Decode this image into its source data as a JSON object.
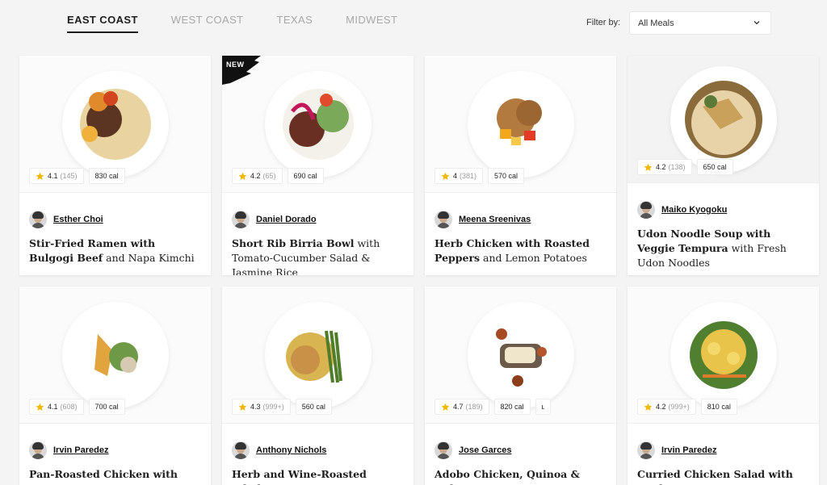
{
  "tabs": [
    {
      "label": "EAST COAST",
      "active": true
    },
    {
      "label": "WEST COAST",
      "active": false
    },
    {
      "label": "TEXAS",
      "active": false
    },
    {
      "label": "MIDWEST",
      "active": false
    }
  ],
  "filter": {
    "label": "Filter by:",
    "selected": "All Meals"
  },
  "colors": {
    "star": "#f5b800",
    "text": "#1e1e1e",
    "muted": "#a8a8a8",
    "badge": "#111111"
  },
  "cards": [
    {
      "rating": "4.1",
      "count": "(145)",
      "cal": "830 cal",
      "chef": "Esther Choi",
      "title_bold": "Stir-Fried Ramen with Bulgogi Beef",
      "title_rest": " and Napa Kimchi",
      "new": false
    },
    {
      "rating": "4.2",
      "count": "(65)",
      "cal": "690 cal",
      "chef": "Daniel Dorado",
      "title_bold": "Short Rib Birria Bowl",
      "title_rest": " with Tomato-Cucumber Salad & Jasmine Rice",
      "new": true,
      "new_label": "NEW"
    },
    {
      "rating": "4",
      "count": "(381)",
      "cal": "570 cal",
      "chef": "Meena Sreenivas",
      "title_bold": "Herb Chicken with Roasted Peppers",
      "title_rest": " and Lemon Potatoes",
      "new": false
    },
    {
      "rating": "4.2",
      "count": "(138)",
      "cal": "650 cal",
      "chef": "Maiko Kyogoku",
      "title_bold": "Udon Noodle Soup with Veggie Tempura",
      "title_rest": " with Fresh Udon Noodles",
      "new": false
    },
    {
      "rating": "4.1",
      "count": "(608)",
      "cal": "700 cal",
      "chef": "Irvin Paredez",
      "title_bold": "Pan-Roasted Chicken with Lemon-",
      "title_rest": "",
      "new": false
    },
    {
      "rating": "4.3",
      "count": "(999+)",
      "cal": "560 cal",
      "chef": "Anthony Nichols",
      "title_bold": "Herb and Wine-Roasted Whole",
      "title_rest": "",
      "new": false
    },
    {
      "rating": "4.7",
      "count": "(189)",
      "cal": "820 cal",
      "extra": "ʟ",
      "chef": "Jose Garces",
      "title_bold": "Adobo Chicken, Quinoa & Kale",
      "title_rest": "",
      "new": false
    },
    {
      "rating": "4.2",
      "count": "(999+)",
      "cal": "810 cal",
      "chef": "Irvin Paredez",
      "title_bold": "Curried Chicken Salad with Apple",
      "title_rest": "",
      "new": false
    }
  ]
}
